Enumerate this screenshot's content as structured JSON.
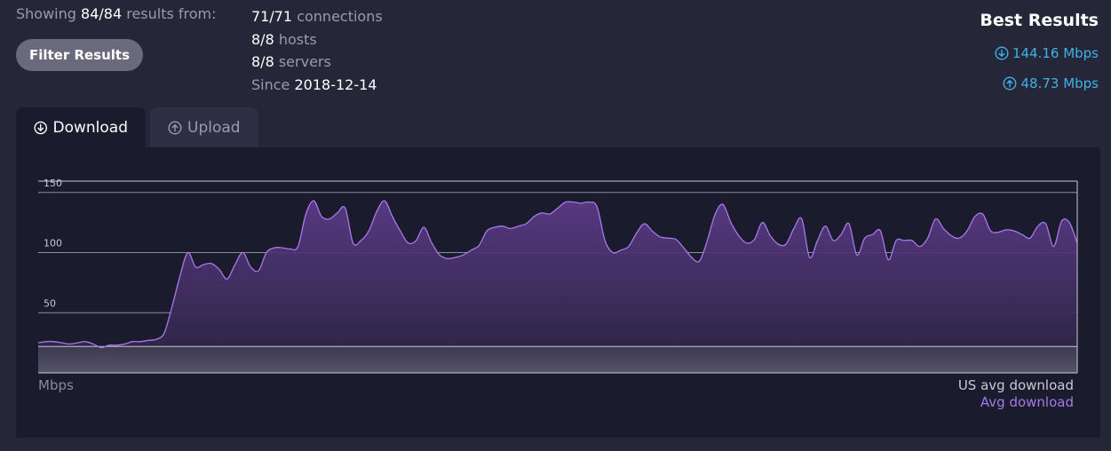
{
  "summary": {
    "prefix": "Showing",
    "count": "84/84",
    "suffix": "results from:"
  },
  "filter_button": {
    "label": "Filter Results"
  },
  "stats": [
    {
      "value": "71/71",
      "label": "connections"
    },
    {
      "value": "8/8",
      "label": "hosts"
    },
    {
      "value": "8/8",
      "label": "servers"
    },
    {
      "value": "2018-12-14",
      "label": "Since"
    }
  ],
  "best_results": {
    "title": "Best Results",
    "download": "144.16 Mbps",
    "upload": "48.73 Mbps",
    "download_icon": "arrow-down-circle-icon",
    "upload_icon": "arrow-up-circle-icon",
    "color": "#3fb2e6"
  },
  "tabs": [
    {
      "label": "Download",
      "icon": "arrow-down-circle-icon",
      "active": true
    },
    {
      "label": "Upload",
      "icon": "arrow-up-circle-icon",
      "active": false
    }
  ],
  "chart_data": {
    "type": "area",
    "ylabel": "Mbps",
    "yticks": [
      50,
      100,
      150
    ],
    "ylim": [
      0,
      160
    ],
    "grid": true,
    "reference_line": {
      "name": "US avg download",
      "value": 22,
      "color": "#c8c8d6"
    },
    "series": [
      {
        "name": "Avg download",
        "color": "#a878e8",
        "values": [
          25,
          26,
          26,
          25,
          24,
          25,
          26,
          24,
          21,
          23,
          23,
          24,
          26,
          26,
          27,
          28,
          33,
          55,
          80,
          100,
          88,
          90,
          91,
          86,
          78,
          90,
          100,
          88,
          85,
          100,
          104,
          104,
          103,
          105,
          132,
          143,
          130,
          128,
          133,
          137,
          108,
          110,
          118,
          134,
          143,
          130,
          118,
          108,
          110,
          121,
          108,
          98,
          95,
          96,
          98,
          102,
          106,
          118,
          121,
          122,
          120,
          122,
          124,
          130,
          133,
          132,
          137,
          142,
          142,
          141,
          142,
          138,
          110,
          100,
          102,
          105,
          116,
          124,
          118,
          113,
          112,
          111,
          104,
          96,
          93,
          110,
          132,
          140,
          125,
          114,
          108,
          111,
          125,
          114,
          107,
          107,
          120,
          128,
          96,
          110,
          122,
          110,
          115,
          124,
          98,
          112,
          115,
          118,
          94,
          110,
          110,
          110,
          105,
          112,
          128,
          120,
          114,
          112,
          118,
          130,
          132,
          118,
          117,
          119,
          118,
          115,
          112,
          122,
          124,
          105,
          126,
          125,
          108
        ],
        "x_start": 0,
        "x_end": 132
      }
    ],
    "legend": [
      "US avg download",
      "Avg download"
    ],
    "legend_position": "bottom-right"
  }
}
